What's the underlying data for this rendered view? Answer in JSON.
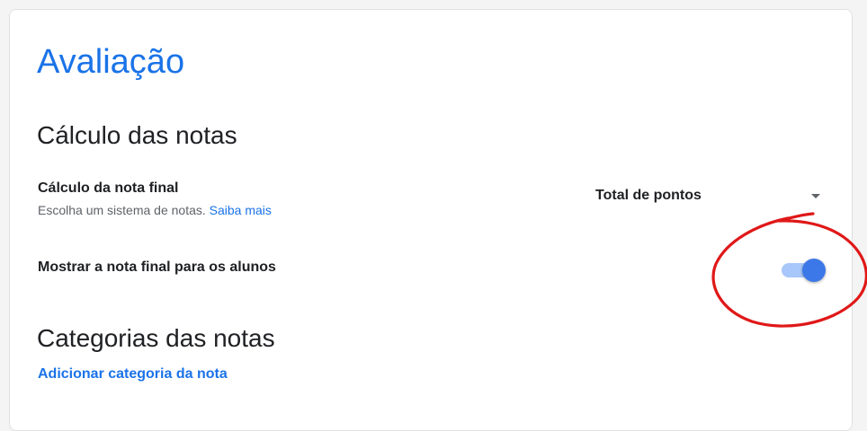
{
  "page": {
    "title": "Avaliação"
  },
  "grading": {
    "section_title": "Cálculo das notas",
    "final_grade": {
      "label": "Cálculo da nota final",
      "description": "Escolha um sistema de notas.",
      "learn_more": "Saiba mais",
      "selected": "Total de pontos"
    },
    "show_final_grade": {
      "label": "Mostrar a nota final para os alunos",
      "enabled": true
    }
  },
  "categories": {
    "section_title": "Categorias das notas",
    "add_link": "Adicionar categoria da nota"
  },
  "colors": {
    "accent": "#1a73e8",
    "toggle_track": "#a8c7fa",
    "toggle_thumb": "#3c78e8",
    "annotation": "#e01818"
  },
  "icons": {
    "dropdown": "caret-down-icon",
    "annotation": "hand-drawn-circle"
  }
}
